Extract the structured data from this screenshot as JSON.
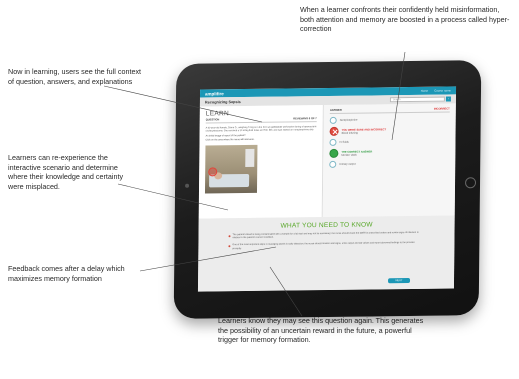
{
  "callouts": {
    "top": "When a learner confronts their confidently held misinformation, both attention and memory are boosted in a process called hyper-correction",
    "learning": "Now in learning, users see the full context of question, answers, and explanations",
    "reexperience": "Learners can re-experience the interactive scenario and determine where their knowledge and certainty were misplaced.",
    "feedback": "Feedback comes after a delay which maximizes memory formation",
    "bottom": "Learners know they may see this question again. This generates the possibility of an uncertain reward in the future, a powerful trigger for memory formation."
  },
  "app": {
    "logo": "amplifire",
    "nav": [
      "Home",
      "Course name"
    ],
    "course_title": "Recognizing Sepsis",
    "search_placeholder": "Search",
    "search_button": "›"
  },
  "question_panel": {
    "mode": "LEARN",
    "label": "QUESTION",
    "review": "REVIEWING 6 OF 7",
    "text": "A 62-year-old female, Diane D., weighing 74 kg is in the ICU s/p gallbladder perforation during a laparoscopic cholecystectomy. She received a 30 ml/kg fluid bolus at 0700. RN, and was started on norepinephrine drip.",
    "link": "An initial image of report of the patient?",
    "prompt": "Click on the area where the nurse will intervene."
  },
  "answer_panel": {
    "label": "ANSWER",
    "status": "INCORRECT",
    "options": [
      {
        "text": "Norepinephrine",
        "state": "neutral"
      },
      {
        "text": "Blood infusing",
        "tag": "YOU WERE SURE AND INCORRECT",
        "state": "wrong"
      },
      {
        "text": "IV fluids",
        "state": "neutral"
      },
      {
        "text": "Monitor vitals",
        "tag": "THE CORRECT ANSWER",
        "state": "correct"
      },
      {
        "text": "Urinary output",
        "tag": "",
        "state": "neutral"
      }
    ]
  },
  "learn_panel": {
    "title": "WHAT YOU NEED TO KNOW",
    "bullets": [
      "The patient's blood is being contaminated with a sample for a lab test and may not be necessary; the nurse should check the MAR for prescribed orders and review signs of infection in relation to the patient's current condition.",
      "One of the most important steps in managing sepsis is early detection; the nurse should monitor vital signs, urine output and lab values and report abnormal findings to the provider promptly."
    ],
    "next_button": "NEXT"
  }
}
